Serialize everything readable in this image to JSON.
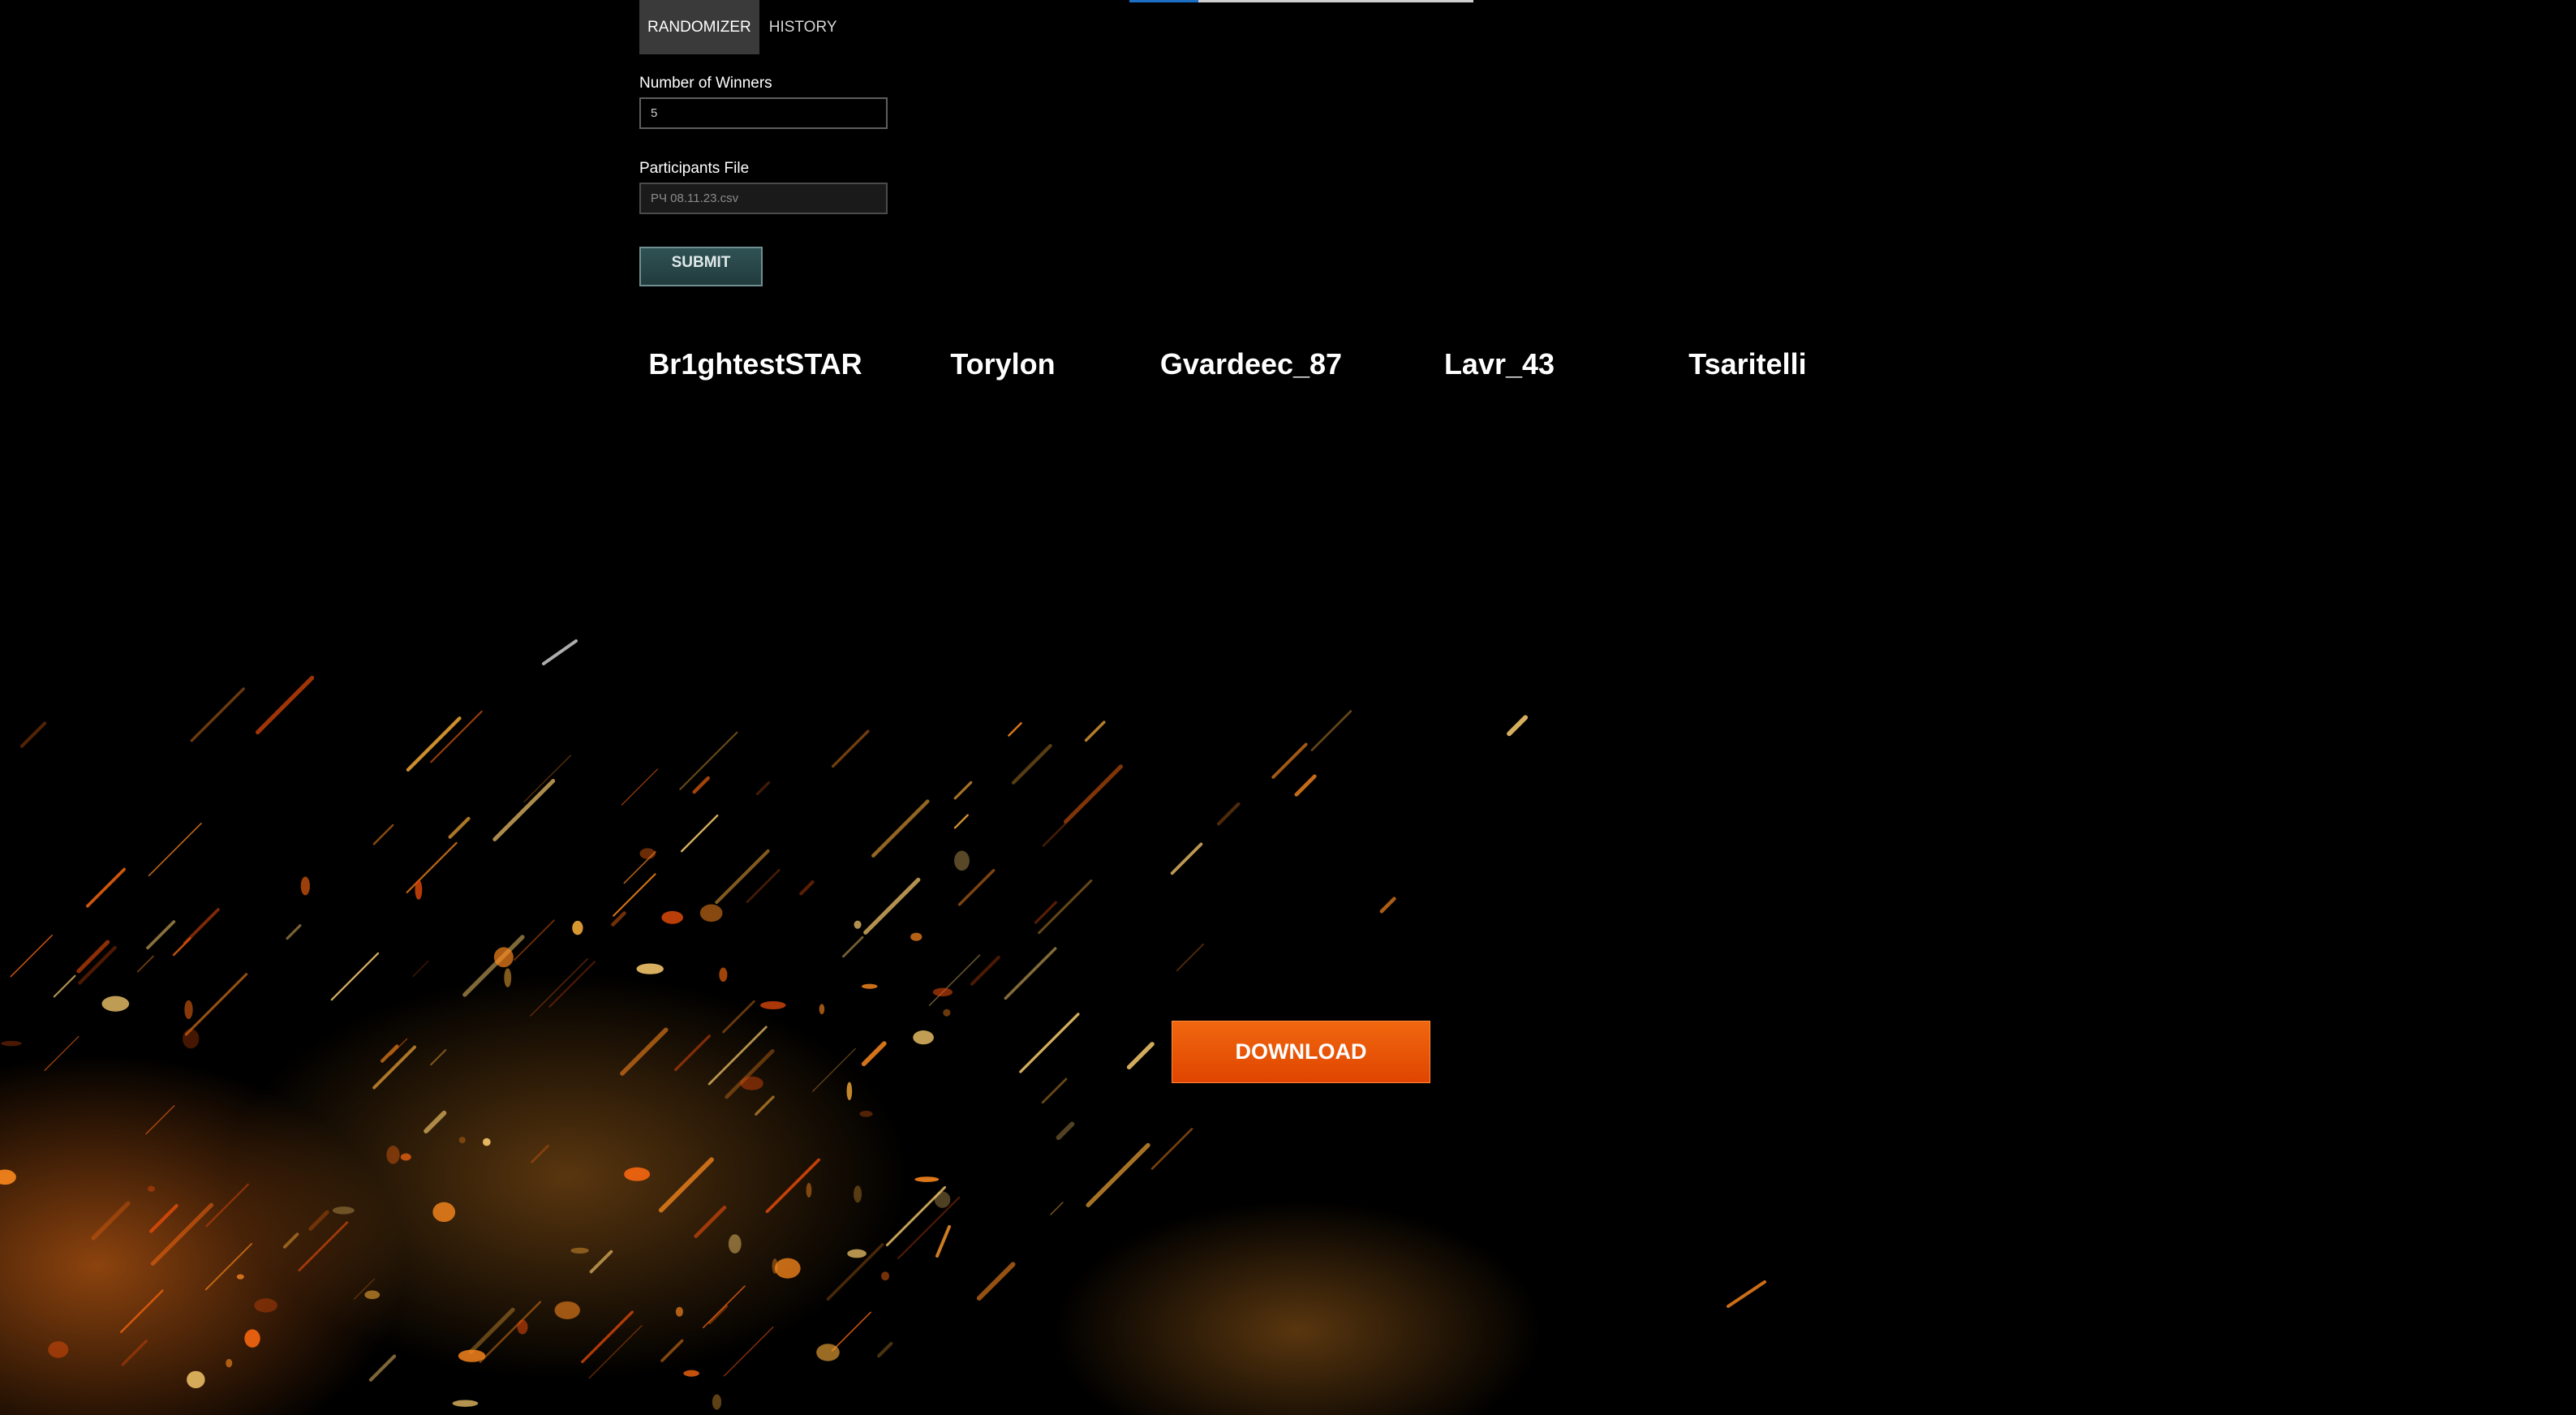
{
  "progress": {
    "fraction": 0.2
  },
  "tabs": [
    {
      "label": "RANDOMIZER",
      "active": true
    },
    {
      "label": "HISTORY",
      "active": false
    }
  ],
  "form": {
    "winners_label": "Number of Winners",
    "winners_value": "5",
    "file_label": "Participants File",
    "file_name": "РЧ 08.11.23.csv",
    "submit_label": "SUBMIT"
  },
  "winners": [
    "Br1ghtestSTAR",
    "Torylon",
    "Gvardeec_87",
    "Lavr_43",
    "Tsaritelli"
  ],
  "download_label": "DOWNLOAD",
  "colors": {
    "accent_orange": "#e8560a",
    "submit_teal": "#2f5254",
    "progress_blue": "#1c6fc4"
  }
}
